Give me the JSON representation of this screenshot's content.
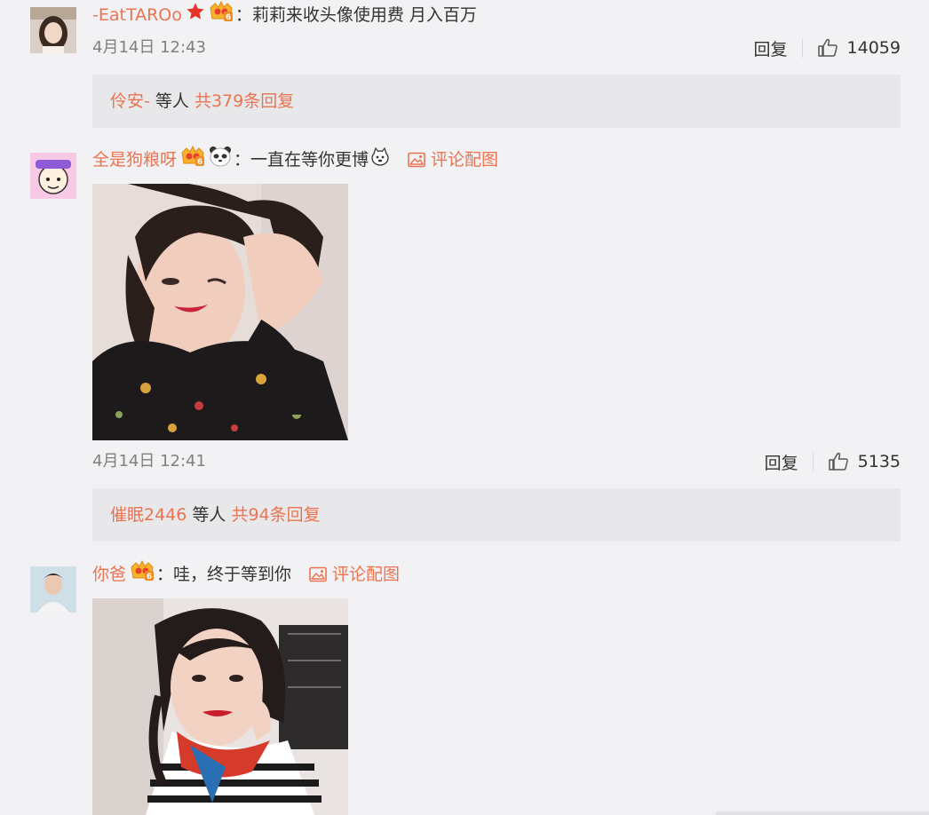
{
  "comments": [
    {
      "username": "-EatTAROo",
      "text": "莉莉来收头像使用费 月入百万",
      "time": "4月14日 12:43",
      "reply_label": "回复",
      "likes": "14059",
      "replies": {
        "user": "伶安-",
        "mid": " 等人 ",
        "total": "共379条回复"
      }
    },
    {
      "username": "全是狗粮呀",
      "text": "一直在等你更博",
      "pic_link": "评论配图",
      "time": "4月14日 12:41",
      "reply_label": "回复",
      "likes": "5135",
      "replies": {
        "user": "催眠2446",
        "mid": " 等人 ",
        "total": "共94条回复"
      }
    },
    {
      "username": "你爸",
      "text": "哇，终于等到你",
      "pic_link": "评论配图"
    }
  ],
  "colon": "：",
  "icons": {
    "star": "red-star-icon",
    "vip": "vip-crown-icon",
    "panda": "panda-emoji-icon",
    "image": "image-icon",
    "like": "thumbs-up-icon"
  },
  "colors": {
    "link": "#eb7350",
    "background": "#f2f2f5",
    "reply_box": "#e8e8eb"
  }
}
